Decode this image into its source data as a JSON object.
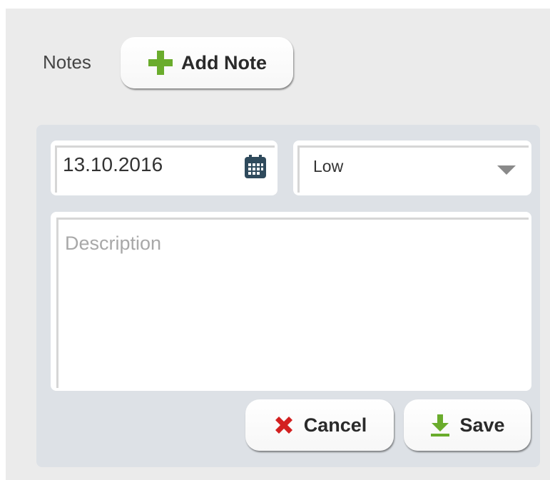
{
  "notes": {
    "label": "Notes",
    "add_button_label": "Add Note"
  },
  "form": {
    "date_value": "13.10.2016",
    "priority_selected": "Low",
    "description_value": "",
    "description_placeholder": "Description",
    "cancel_label": "Cancel",
    "save_label": "Save"
  },
  "icons": {
    "add": "plus-icon",
    "calendar": "calendar-icon",
    "dropdown": "chevron-down-icon",
    "cancel": "close-icon",
    "save": "download-icon"
  },
  "colors": {
    "add_icon": "#6aac2c",
    "cancel_icon": "#d32020",
    "save_icon": "#6aac2c",
    "calendar_icon": "#2f4a5c"
  }
}
